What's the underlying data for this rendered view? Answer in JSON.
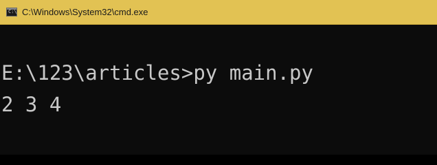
{
  "window": {
    "title": "C:\\Windows\\System32\\cmd.exe",
    "icon": "cmd-prompt-icon"
  },
  "console": {
    "lines": [
      "E:\\123\\articles>py main.py",
      "2 3 4"
    ]
  },
  "colors": {
    "titlebar": "#e2c253",
    "console_background": "#0c0c0c",
    "console_text": "#c8c8c8"
  }
}
